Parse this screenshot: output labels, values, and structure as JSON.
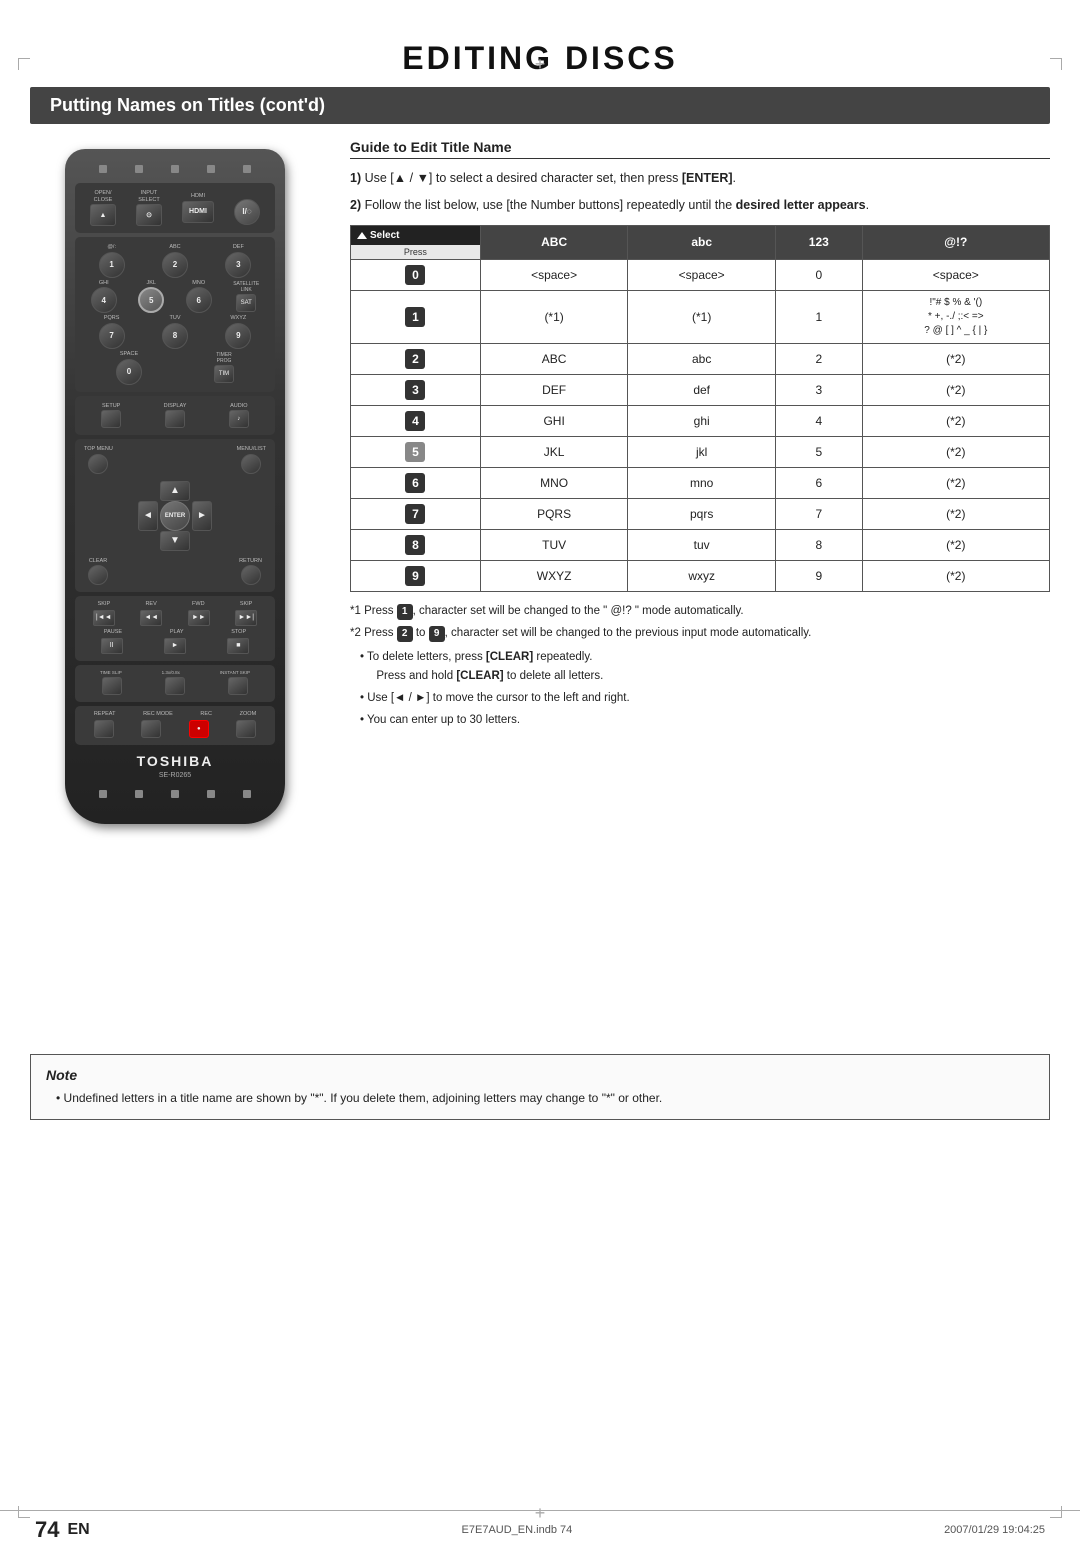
{
  "page": {
    "main_title": "EDITING DISCS",
    "section_title": "Putting Names on Titles (cont'd)",
    "footer_filename": "E7E7AUD_EN.indb  74",
    "footer_date": "2007/01/29  19:04:25",
    "page_number": "74",
    "page_label": "EN"
  },
  "remote": {
    "brand": "TOSHIBA",
    "model": "SE-R0265",
    "buttons": {
      "open_close": "OPEN/\nCLOSE",
      "input_select": "INPUT\nSELECT",
      "hdmi": "HDMI",
      "power": "I/◌",
      "at_colon": "@/:",
      "abc": "ABC",
      "def": "DEF",
      "num1": "1",
      "num2": "2",
      "num3": "3",
      "ghi": "GHI",
      "jkl": "JKL",
      "mno": "MNO",
      "num4": "4",
      "num5": "5",
      "num6": "6",
      "satellite_link": "SATELLITE\nLINK",
      "pqrs": "PQRS",
      "tuv": "TUV",
      "wxyz": "WXYZ",
      "num7": "7",
      "num8": "8",
      "num9": "9",
      "space": "SPACE",
      "timer_prog": "TIMER\nPROG",
      "num0": "0",
      "setup": "SETUP",
      "display": "DISPLAY",
      "audio": "AUDIO",
      "top_menu": "TOP MENU",
      "menu_list": "MENU/LIST",
      "clear": "CLEAR",
      "return": "RETURN",
      "enter": "ENTER",
      "skip_rev": "SKIP",
      "rev": "REV",
      "fwd": "FWD",
      "skip_fwd": "SKIP",
      "pause": "PAUSE",
      "play": "PLAY",
      "stop": "STOP",
      "time_slip": "TIME SLIP",
      "play_speed": "1.3x / 0.8x PLAY",
      "instant_skip": "INSTANT SKIP",
      "repeat": "REPEAT",
      "rec_mode": "REC MODE",
      "rec": "REC",
      "zoom": "ZOOM"
    }
  },
  "guide": {
    "title": "Guide to Edit Title Name",
    "step1": "Use [▲ / ▼] to select a desired character set, then press [ENTER].",
    "step2": "Follow the list below, use [the Number buttons] repeatedly until the desired letter appears.",
    "table": {
      "headers": [
        "Select",
        "ABC",
        "abc",
        "123",
        "@!?"
      ],
      "sub_headers": [
        "Press",
        "",
        "",
        "",
        ""
      ],
      "rows": [
        {
          "btn": "0",
          "btn_style": "dark",
          "abc": "<space>",
          "abc_lower": "<space>",
          "num": "0",
          "special": "<space>"
        },
        {
          "btn": "1",
          "btn_style": "dark",
          "abc": "(*1)",
          "abc_lower": "(*1)",
          "num": "1",
          "special": "!\"# $ % & '()\n* +, -./ ;: < =>\n? @ [ ] ^ _ { | }"
        },
        {
          "btn": "2",
          "btn_style": "dark",
          "abc": "ABC",
          "abc_lower": "abc",
          "num": "2",
          "special": "(*2)"
        },
        {
          "btn": "3",
          "btn_style": "dark",
          "abc": "DEF",
          "abc_lower": "def",
          "num": "3",
          "special": "(*2)"
        },
        {
          "btn": "4",
          "btn_style": "dark",
          "abc": "GHI",
          "abc_lower": "ghi",
          "num": "4",
          "special": "(*2)"
        },
        {
          "btn": "5",
          "btn_style": "outline",
          "abc": "JKL",
          "abc_lower": "jkl",
          "num": "5",
          "special": "(*2)"
        },
        {
          "btn": "6",
          "btn_style": "dark",
          "abc": "MNO",
          "abc_lower": "mno",
          "num": "6",
          "special": "(*2)"
        },
        {
          "btn": "7",
          "btn_style": "dark",
          "abc": "PQRS",
          "abc_lower": "pqrs",
          "num": "7",
          "special": "(*2)"
        },
        {
          "btn": "8",
          "btn_style": "dark",
          "abc": "TUV",
          "abc_lower": "tuv",
          "num": "8",
          "special": "(*2)"
        },
        {
          "btn": "9",
          "btn_style": "dark",
          "abc": "WXYZ",
          "abc_lower": "wxyz",
          "num": "9",
          "special": "(*2)"
        }
      ]
    },
    "footnote1": "*1 Press 1, character set will be changed to the \" @!? \" mode automatically.",
    "footnote2": "*2 Press 2 to 9, character set will be changed to the previous input mode automatically.",
    "bullet1": "To delete letters, press [CLEAR] repeatedly. Press and hold [CLEAR] to delete all letters.",
    "bullet2": "Use [◄ / ►] to move the cursor to the left and right.",
    "bullet3": "You can enter up to 30 letters."
  },
  "note": {
    "title": "Note",
    "bullet1": "Undefined letters in a title name are shown by \"*\". If you delete them, adjoining letters may change to \"*\" or other."
  }
}
